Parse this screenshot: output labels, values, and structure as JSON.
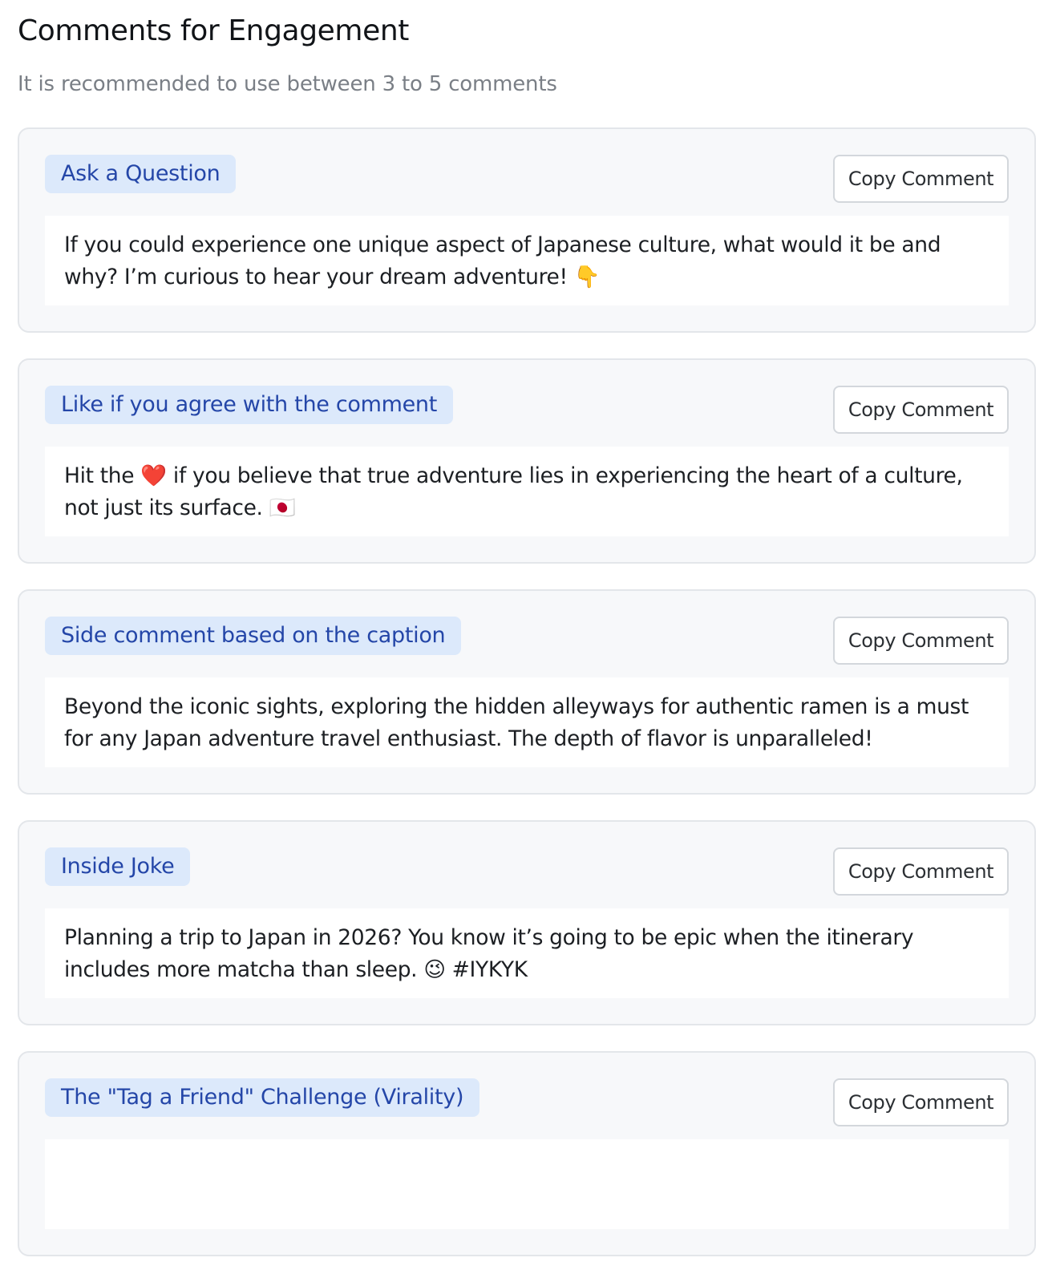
{
  "header": {
    "title": "Comments for Engagement",
    "subtitle": "It is recommended to use between 3 to 5 comments"
  },
  "cards": [
    {
      "tag": "Ask a Question",
      "copy_label": "Copy Comment",
      "text": "If you could experience one unique aspect of Japanese culture, what would it be and why? I’m curious to hear your dream adventure! 👇"
    },
    {
      "tag": "Like if you agree with the comment",
      "copy_label": "Copy Comment",
      "text": "Hit the ❤️ if you believe that true adventure lies in experiencing the heart of a culture, not just its surface. 🇯🇵"
    },
    {
      "tag": "Side comment based on the caption",
      "copy_label": "Copy Comment",
      "text": "Beyond the iconic sights, exploring the hidden alleyways for authentic ramen is a must for any Japan adventure travel enthusiast. The depth of flavor is unparalleled!"
    },
    {
      "tag": "Inside Joke",
      "copy_label": "Copy Comment",
      "text": "Planning a trip to Japan in 2026? You know it’s going to be epic when the itinerary includes more matcha than sleep. 😉 #IYKYK"
    },
    {
      "tag": "The \"Tag a Friend\" Challenge (Virality)",
      "copy_label": "Copy Comment",
      "text": ""
    }
  ]
}
